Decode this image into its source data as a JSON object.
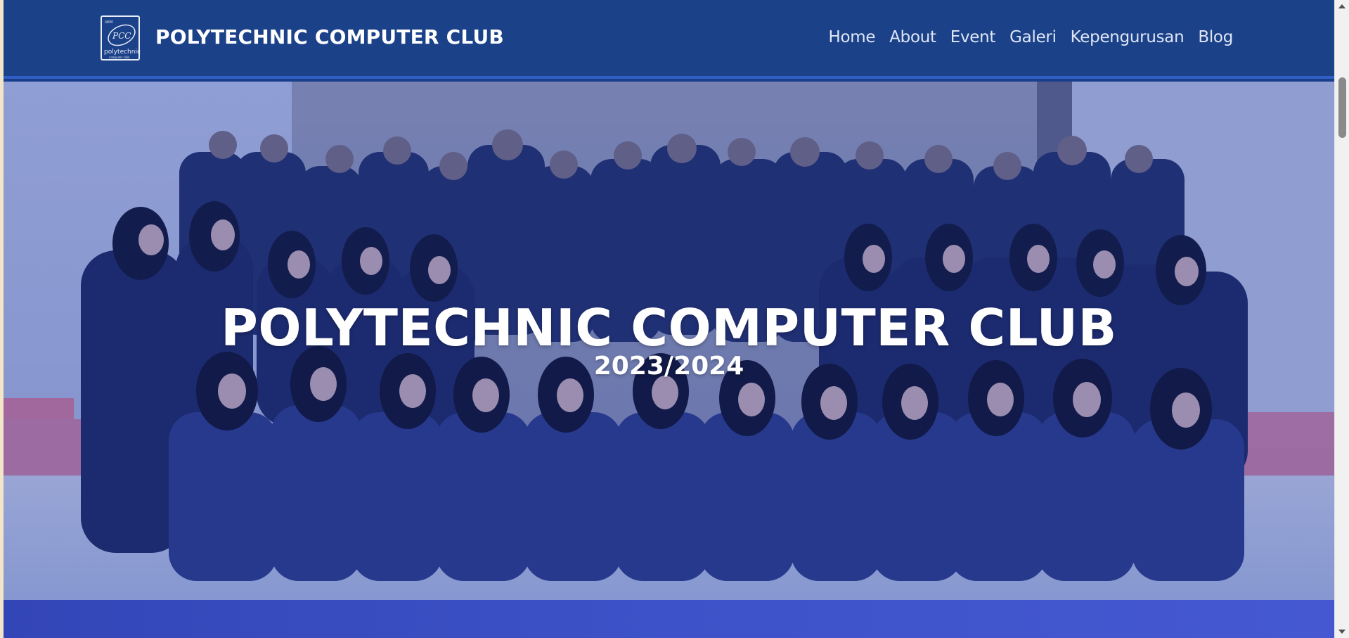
{
  "navbar": {
    "brand_title": "POLYTECHNIC COMPUTER CLUB",
    "logo_text_main": "PCC",
    "logo_text_sub": "polytechnic",
    "logo_text_small": "computer club",
    "logo_text_top": "UKM",
    "links": [
      "Home",
      "About",
      "Event",
      "Galeri",
      "Kepengurusan",
      "Blog"
    ]
  },
  "hero": {
    "title": "POLYTECHNIC COMPUTER CLUB",
    "subtitle": "2023/2024"
  },
  "colors": {
    "navbar_bg": "#1b4189",
    "accent": "#2f5fc4",
    "band": "#3d52c8",
    "text": "#ffffff"
  }
}
